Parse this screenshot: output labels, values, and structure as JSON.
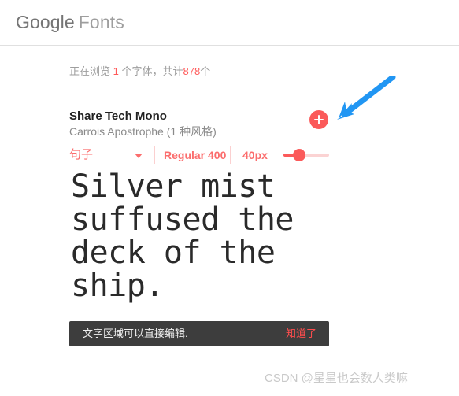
{
  "header": {
    "logo_primary": "Google",
    "logo_secondary": "Fonts"
  },
  "browse_status": {
    "prefix": "正在浏览",
    "count": "1",
    "middle": "个字体，共计",
    "total": "878",
    "suffix": "个"
  },
  "font_card": {
    "name": "Share Tech Mono",
    "foundry": "Carrois Apostrophe (1 种风格)",
    "add_button_label": "+"
  },
  "controls": {
    "sample_type": "句子",
    "caret_icon": "chevron-down-icon",
    "weight": "Regular 400",
    "size": "40px",
    "slider_value": 30
  },
  "preview": {
    "text": "Silver mist suffused the deck of the ship."
  },
  "snackbar": {
    "message": "文字区域可以直接编辑.",
    "action": "知道了"
  },
  "annotation": {
    "arrow_icon": "arrow-pointing-down-left",
    "arrow_color": "#2196f3"
  },
  "watermark": {
    "text": "CSDN @星星也会数人类嘛"
  },
  "colors": {
    "accent": "#fb5a5a",
    "accent_light": "#fbd3d3",
    "logo_primary": "#757575",
    "logo_secondary": "#9e9e9e",
    "snackbar_bg": "#3d3d3d",
    "snackbar_action": "#ff4d4d",
    "preview_text": "#2a2a2a"
  }
}
